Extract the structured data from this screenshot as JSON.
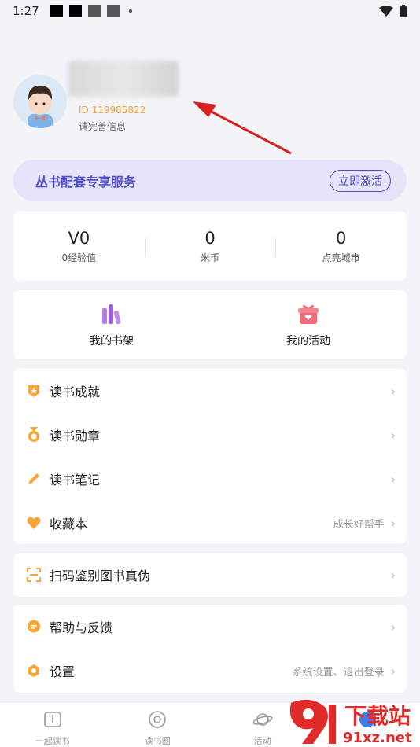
{
  "status": {
    "time": "1:27"
  },
  "profile": {
    "user_id": "ID 119985822",
    "complete_info": "请完善信息"
  },
  "service": {
    "title": "丛书配套专享服务",
    "activate_label": "立即激活"
  },
  "stats": [
    {
      "value": "V0",
      "label": "0经验值"
    },
    {
      "value": "0",
      "label": "米币"
    },
    {
      "value": "0",
      "label": "点亮城市"
    }
  ],
  "quick": {
    "bookshelf": "我的书架",
    "activities": "我的活动"
  },
  "menu": {
    "achievements": "读书成就",
    "medals": "读书勋章",
    "notes": "读书笔记",
    "collection": "收藏本",
    "collection_hint": "成长好帮手",
    "scan": "扫码鉴别图书真伪",
    "help": "帮助与反馈",
    "settings": "设置",
    "settings_hint": "系统设置、退出登录"
  },
  "nav": {
    "read_together": "一起读书",
    "reading_circle": "读书圈",
    "activity": "活动"
  },
  "watermark": {
    "brand": "下载站",
    "domain": "91xz.net"
  },
  "colors": {
    "accent": "#5450c9",
    "orange": "#f0a23a",
    "background": "#f3f4f8"
  }
}
